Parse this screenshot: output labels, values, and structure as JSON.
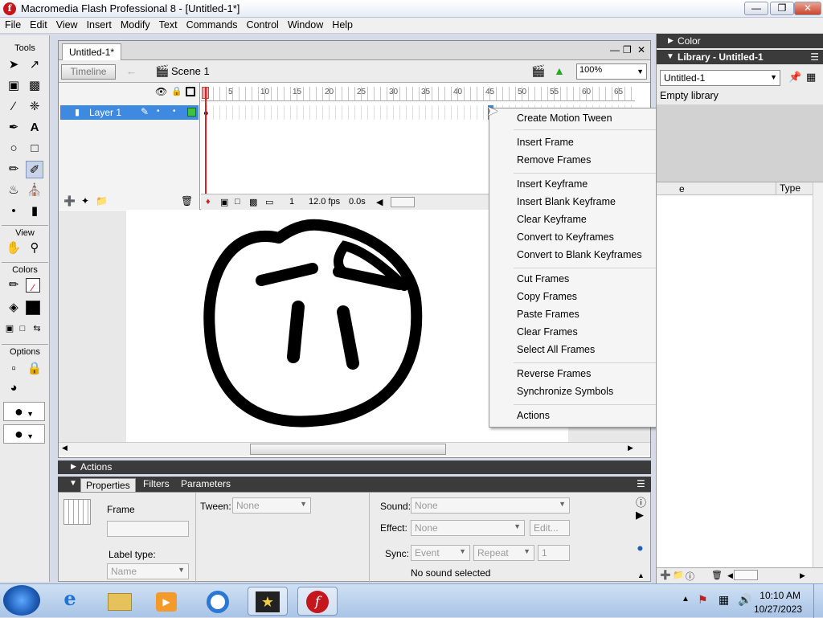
{
  "window": {
    "title": "Macromedia Flash Professional 8 - [Untitled-1*]",
    "app_icon_glyph": "f"
  },
  "menu": [
    "File",
    "Edit",
    "View",
    "Insert",
    "Modify",
    "Text",
    "Commands",
    "Control",
    "Window",
    "Help"
  ],
  "tools": {
    "tools_label": "Tools",
    "view_label": "View",
    "colors_label": "Colors",
    "options_label": "Options"
  },
  "document": {
    "tab_title": "Untitled-1*",
    "timeline_button": "Timeline",
    "scene_label": "Scene 1",
    "zoom": "100%",
    "layer_name": "Layer 1",
    "ruler_ticks": [
      "1",
      "5",
      "10",
      "15",
      "20",
      "25",
      "30",
      "35",
      "40",
      "45",
      "50",
      "55",
      "60",
      "65"
    ],
    "status_frame": "1",
    "status_fps": "12.0 fps",
    "status_time": "0.0s"
  },
  "context_menu": {
    "items": [
      {
        "label": "Create Motion Tween",
        "enabled": false
      },
      {
        "label": "Insert Frame",
        "enabled": true
      },
      {
        "label": "Remove Frames",
        "enabled": false
      },
      {
        "label": "Insert Keyframe",
        "enabled": true
      },
      {
        "label": "Insert Blank Keyframe",
        "enabled": true
      },
      {
        "label": "Clear Keyframe",
        "enabled": false
      },
      {
        "label": "Convert to Keyframes",
        "enabled": true
      },
      {
        "label": "Convert to Blank Keyframes",
        "enabled": true
      },
      {
        "label": "Cut Frames",
        "enabled": false
      },
      {
        "label": "Copy Frames",
        "enabled": false
      },
      {
        "label": "Paste Frames",
        "enabled": false
      },
      {
        "label": "Clear Frames",
        "enabled": false
      },
      {
        "label": "Select All Frames",
        "enabled": true
      },
      {
        "label": "Reverse Frames",
        "enabled": false
      },
      {
        "label": "Synchronize Symbols",
        "enabled": false
      },
      {
        "label": "Actions",
        "enabled": true
      }
    ]
  },
  "actions_panel": {
    "title": "Actions"
  },
  "properties": {
    "tabs": [
      "Properties",
      "Filters",
      "Parameters"
    ],
    "frame_label": "Frame",
    "tween_label": "Tween:",
    "tween_value": "None",
    "label_type_label": "Label type:",
    "label_type_value": "Name",
    "sound_label": "Sound:",
    "sound_value": "None",
    "effect_label": "Effect:",
    "effect_value": "None",
    "edit_button": "Edit...",
    "sync_label": "Sync:",
    "sync_value": "Event",
    "repeat_value": "Repeat",
    "repeat_count": "1",
    "no_sound_text": "No sound selected"
  },
  "right_panels": {
    "color_title": "Color",
    "library_title": "Library - Untitled-1",
    "library_select": "Untitled-1",
    "empty_text": "Empty library",
    "col_name": "e",
    "col_type": "Type"
  },
  "taskbar": {
    "time": "10:10 AM",
    "date": "10/27/2023"
  }
}
